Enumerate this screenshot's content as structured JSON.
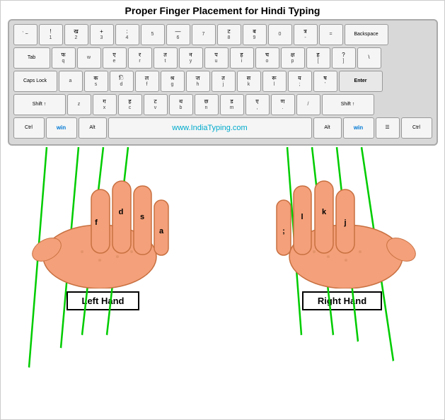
{
  "title": "Proper Finger Placement for Hindi Typing",
  "watermark": "www.IndiaTyping.com",
  "left_hand_label": "Left Hand",
  "right_hand_label": "Right Hand",
  "rows": [
    {
      "keys": [
        {
          "label": "` ~",
          "sub": ""
        },
        {
          "label": "1 !",
          "sub": ""
        },
        {
          "label": "2 @",
          "sub": "ख"
        },
        {
          "label": "3 #",
          "sub": "+"
        },
        {
          "label": "4 $",
          "sub": ":"
        },
        {
          "label": "5 %",
          "sub": ""
        },
        {
          "label": "6 ^",
          "sub": "—"
        },
        {
          "label": "7 &",
          "sub": ""
        },
        {
          "label": "8 *",
          "sub": "ट"
        },
        {
          "label": "9 (",
          "sub": "ब"
        },
        {
          "label": "0 )",
          "sub": ""
        },
        {
          "label": "- _",
          "sub": "त्र"
        },
        {
          "label": "= +",
          "sub": ""
        },
        {
          "label": "Backspace",
          "wide": "backspace"
        }
      ]
    },
    {
      "keys": [
        {
          "label": "Tab",
          "wide": "tab"
        },
        {
          "label": "फ",
          "sub": "Q"
        },
        {
          "label": "",
          "sub": "W"
        },
        {
          "label": "ए",
          "sub": "E"
        },
        {
          "label": "र",
          "sub": "R"
        },
        {
          "label": "त",
          "sub": "T"
        },
        {
          "label": "न",
          "sub": "Y"
        },
        {
          "label": "प",
          "sub": "U"
        },
        {
          "label": "ह",
          "sub": "I"
        },
        {
          "label": "च",
          "sub": "O"
        },
        {
          "label": "क्ष",
          "sub": "P"
        },
        {
          "label": "ह",
          "sub": "["
        },
        {
          "label": "?",
          "sub": "]"
        },
        {
          "label": "\\",
          "sub": ""
        }
      ]
    },
    {
      "keys": [
        {
          "label": "Caps Lock",
          "wide": "caps"
        },
        {
          "label": "",
          "sub": "A"
        },
        {
          "label": "क",
          "sub": "S"
        },
        {
          "label": "ि",
          "sub": "D"
        },
        {
          "label": "ल",
          "sub": "F"
        },
        {
          "label": "श्र",
          "sub": "G"
        },
        {
          "label": "ज",
          "sub": "H"
        },
        {
          "label": "त",
          "sub": "J"
        },
        {
          "label": "स",
          "sub": "K"
        },
        {
          "label": "रू",
          "sub": "L"
        },
        {
          "label": "य",
          "sub": ";"
        },
        {
          "label": "ष",
          "sub": "'"
        },
        {
          "label": "Enter",
          "wide": "enter"
        }
      ]
    },
    {
      "keys": [
        {
          "label": "Shift ↑",
          "wide": "shift-l"
        },
        {
          "label": "",
          "sub": "Z"
        },
        {
          "label": "ग",
          "sub": "X"
        },
        {
          "label": "ह",
          "sub": "C"
        },
        {
          "label": "ट",
          "sub": "V"
        },
        {
          "label": "थ",
          "sub": "B"
        },
        {
          "label": "छ",
          "sub": "N"
        },
        {
          "label": "ड",
          "sub": "M"
        },
        {
          "label": "ए",
          "sub": ","
        },
        {
          "label": "ण",
          "sub": "."
        },
        {
          "label": "",
          "sub": "/"
        },
        {
          "label": "Shift ↑",
          "wide": "shift-r"
        }
      ]
    },
    {
      "keys": [
        {
          "label": "Ctrl",
          "wide": "ctrl"
        },
        {
          "label": "win",
          "wide": "win"
        },
        {
          "label": "Alt",
          "wide": "alt"
        },
        {
          "label": "",
          "wide": "space"
        },
        {
          "label": "Alt",
          "wide": "alt"
        },
        {
          "label": "win",
          "wide": "win"
        },
        {
          "label": "☰",
          "wide": "menu"
        },
        {
          "label": "Ctrl",
          "wide": "ctrl"
        }
      ]
    }
  ]
}
